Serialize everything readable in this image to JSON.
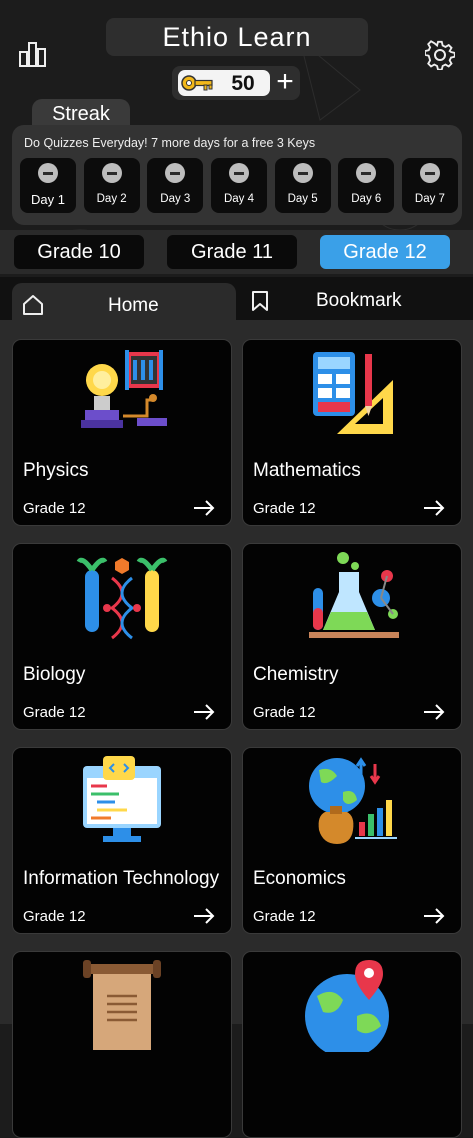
{
  "header": {
    "title": "Ethio Learn",
    "keys_count": "50",
    "plus_symbol": "+"
  },
  "streak": {
    "tab_label": "Streak",
    "message": "Do Quizzes Everyday! 7 more days for a free 3 Keys",
    "days": [
      "Day 1",
      "Day 2",
      "Day 3",
      "Day 4",
      "Day 5",
      "Day 6",
      "Day 7"
    ]
  },
  "grades": {
    "items": [
      "Grade 10",
      "Grade 11",
      "Grade 12"
    ],
    "selected": "Grade 12"
  },
  "nav": {
    "home_label": "Home",
    "bookmark_label": "Bookmark"
  },
  "subjects": [
    {
      "name": "Physics",
      "grade": "Grade  12",
      "icon": "physics-lightbulb-icon"
    },
    {
      "name": "Mathematics",
      "grade": "Grade  12",
      "icon": "math-calculator-icon"
    },
    {
      "name": "Biology",
      "grade": "Grade  12",
      "icon": "biology-dna-icon"
    },
    {
      "name": "Chemistry",
      "grade": "Grade  12",
      "icon": "chemistry-flask-icon"
    },
    {
      "name": "Information  Technology",
      "grade": "Grade  12",
      "icon": "it-monitor-icon"
    },
    {
      "name": "Economics",
      "grade": "Grade  12",
      "icon": "economics-globe-icon"
    },
    {
      "name": "",
      "grade": "",
      "icon": "history-scroll-icon"
    },
    {
      "name": "",
      "grade": "",
      "icon": "geography-globe-icon"
    }
  ],
  "colors": {
    "accent": "#3aa0e8",
    "background": "#1c1c1c",
    "card": "#030303"
  }
}
